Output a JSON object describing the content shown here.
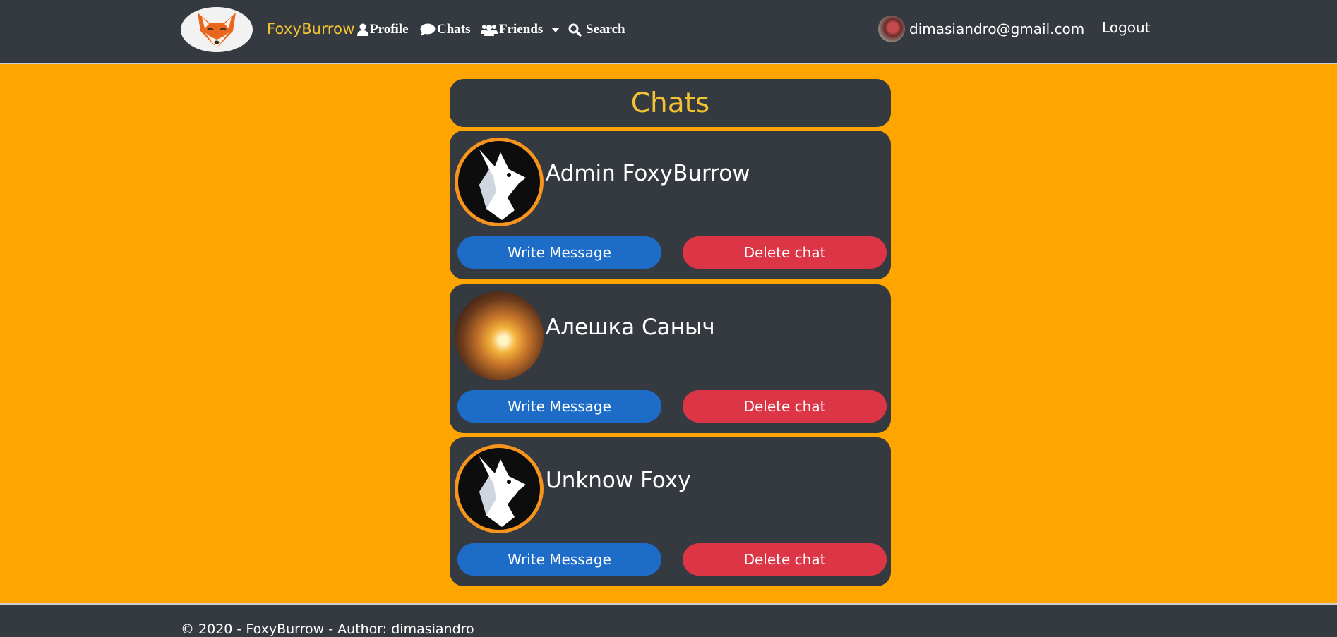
{
  "navbar": {
    "brand": "FoxyBurrow",
    "items": [
      {
        "label": "Profile",
        "icon": "user-icon"
      },
      {
        "label": "Chats",
        "icon": "comment-icon"
      },
      {
        "label": "Friends",
        "icon": "users-icon"
      },
      {
        "label": "Search",
        "icon": "search-icon"
      }
    ],
    "user_email": "dimasiandro@gmail.com",
    "logout": "Logout"
  },
  "page": {
    "title": "Chats"
  },
  "chats": [
    {
      "name": "Admin FoxyBurrow",
      "avatar": "fox-logo-avatar",
      "write_label": "Write Message",
      "delete_label": "Delete chat"
    },
    {
      "name": "Алешка Саныч",
      "avatar": "user-photo-avatar",
      "write_label": "Write Message",
      "delete_label": "Delete chat"
    },
    {
      "name": "Unknow Foxy",
      "avatar": "fox-logo-avatar",
      "write_label": "Write Message",
      "delete_label": "Delete chat"
    }
  ],
  "footer": {
    "text": "© 2020 - FoxyBurrow - Author: dimasiandro"
  },
  "colors": {
    "page_bg": "#FFA500",
    "dark": "#343a40",
    "brand": "#f3c332",
    "primary": "#1d6cc7",
    "danger": "#dc3545"
  }
}
